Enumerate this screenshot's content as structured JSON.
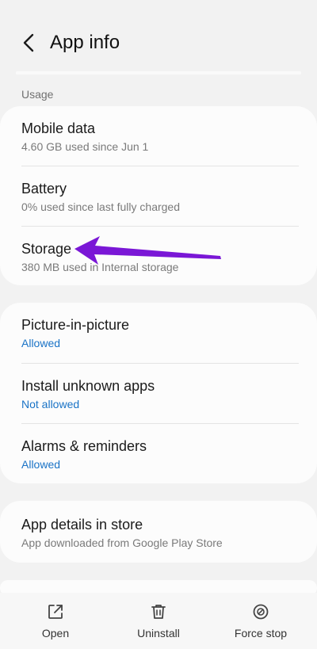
{
  "header": {
    "title": "App info",
    "back_icon": "chevron-left-icon"
  },
  "usage": {
    "section_label": "Usage",
    "items": [
      {
        "title": "Mobile data",
        "subtitle": "4.60 GB used since Jun 1"
      },
      {
        "title": "Battery",
        "subtitle": "0% used since last fully charged"
      },
      {
        "title": "Storage",
        "subtitle": "380 MB used in Internal storage"
      }
    ]
  },
  "permissions": {
    "items": [
      {
        "title": "Picture-in-picture",
        "status": "Allowed"
      },
      {
        "title": "Install unknown apps",
        "status": "Not allowed"
      },
      {
        "title": "Alarms & reminders",
        "status": "Allowed"
      }
    ]
  },
  "store": {
    "title": "App details in store",
    "subtitle": "App downloaded from Google Play Store"
  },
  "bottom_bar": {
    "open_label": "Open",
    "uninstall_label": "Uninstall",
    "force_stop_label": "Force stop"
  },
  "colors": {
    "background": "#f2f2f2",
    "card": "#fcfcfc",
    "status_blue": "#1a73c6",
    "annotation_arrow": "#7a17d6"
  }
}
